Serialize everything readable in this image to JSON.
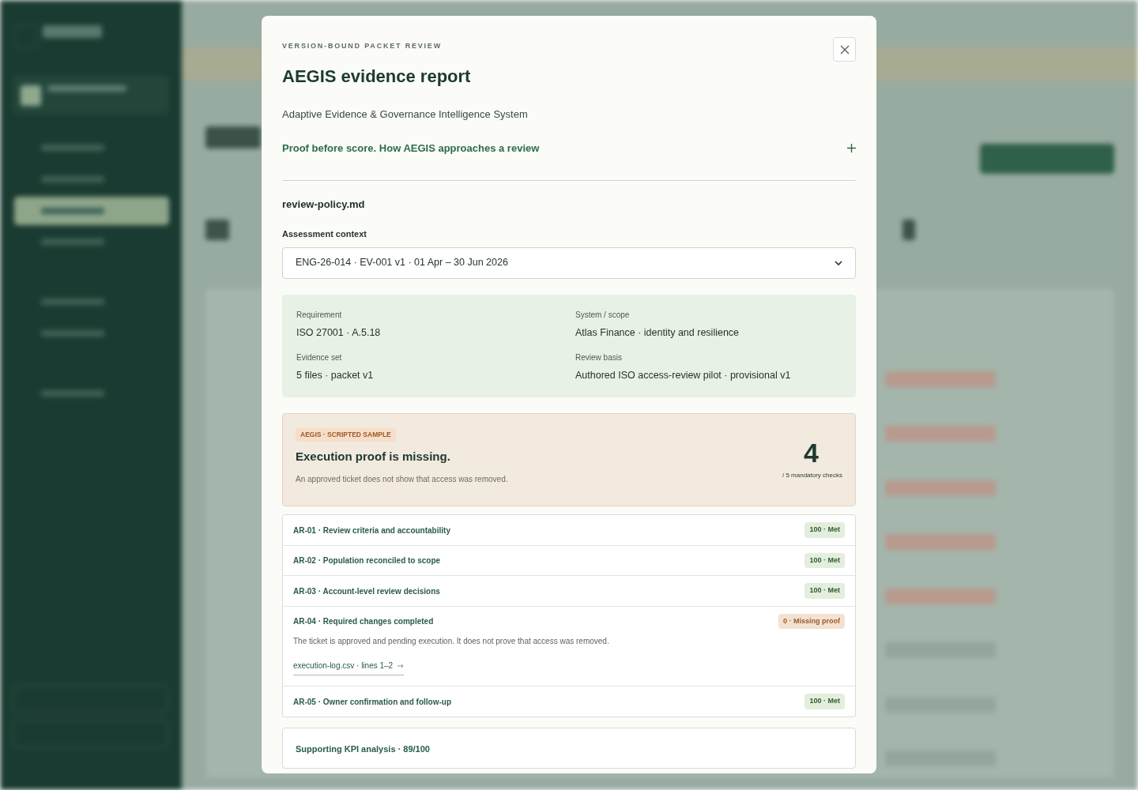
{
  "modal": {
    "eyebrow": "VERSION-BOUND PACKET REVIEW",
    "title": "AEGIS evidence report",
    "subtitle": "Adaptive Evidence & Governance Intelligence System",
    "accordion": {
      "label": "Proof before score. How AEGIS approaches a review",
      "expanded": false
    },
    "file_name": "review-policy.md",
    "context": {
      "label": "Assessment context",
      "value": "ENG-26-014 · EV-001 v1 · 01 Apr – 30 Jun 2026"
    },
    "facts": [
      {
        "label": "Requirement",
        "value": "ISO 27001 · A.5.18"
      },
      {
        "label": "System / scope",
        "value": "Atlas Finance · identity and resilience"
      },
      {
        "label": "Evidence set",
        "value": "5 files · packet v1"
      },
      {
        "label": "Review basis",
        "value": "Authored ISO access-review pilot · provisional v1"
      }
    ],
    "verdict": {
      "tag": "AEGIS · SCRIPTED SAMPLE",
      "headline": "Execution proof is missing.",
      "detail": "An approved ticket does not show that access was removed.",
      "score": "4",
      "score_caption": "/ 5 mandatory checks"
    },
    "checks": [
      {
        "label": "AR-01 · Review criteria and accountability",
        "badge": "100 · Met",
        "kind": "met"
      },
      {
        "label": "AR-02 · Population reconciled to scope",
        "badge": "100 · Met",
        "kind": "met"
      },
      {
        "label": "AR-03 · Account-level review decisions",
        "badge": "100 · Met",
        "kind": "met"
      },
      {
        "label": "AR-04 · Required changes completed",
        "badge": "0 · Missing proof",
        "kind": "missing",
        "detail": "The ticket is approved and pending execution. It does not prove that access was removed.",
        "link": "execution-log.csv · lines 1–2"
      },
      {
        "label": "AR-05 · Owner confirmation and follow-up",
        "badge": "100 · Met",
        "kind": "met"
      }
    ],
    "kpi": "Supporting KPI analysis · 89/100"
  }
}
